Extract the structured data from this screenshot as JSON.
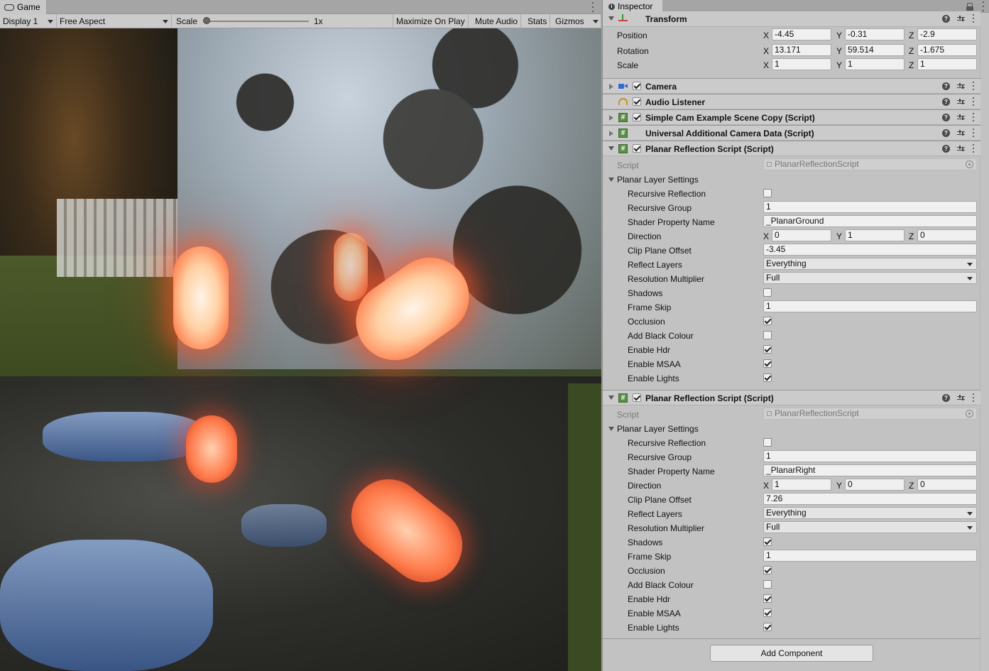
{
  "game": {
    "tab_label": "Game",
    "toolbar": {
      "display": "Display 1",
      "aspect": "Free Aspect",
      "scale_label": "Scale",
      "scale_value": "1x",
      "maximize": "Maximize On Play",
      "mute": "Mute Audio",
      "stats": "Stats",
      "gizmos": "Gizmos"
    }
  },
  "inspector": {
    "tab_label": "Inspector",
    "transform": {
      "title": "Transform",
      "position": {
        "label": "Position",
        "x": "-4.45",
        "y": "-0.31",
        "z": "-2.9"
      },
      "rotation": {
        "label": "Rotation",
        "x": "13.171",
        "y": "59.514",
        "z": "-1.675"
      },
      "scale": {
        "label": "Scale",
        "x": "1",
        "y": "1",
        "z": "1"
      }
    },
    "axis": {
      "x": "X",
      "y": "Y",
      "z": "Z"
    },
    "components": [
      {
        "title": "Camera",
        "checked": true
      },
      {
        "title": "Audio Listener",
        "checked": true
      },
      {
        "title": "Simple Cam Example Scene Copy (Script)",
        "checked": true
      },
      {
        "title": "Universal Additional Camera Data (Script)",
        "checked": false
      }
    ],
    "reflection_scripts": [
      {
        "title": "Planar Reflection Script (Script)",
        "script_label": "Script",
        "script_value": "PlanarReflectionScript",
        "section": "Planar Layer Settings",
        "recursive_reflection": {
          "label": "Recursive Reflection",
          "checked": false
        },
        "recursive_group": {
          "label": "Recursive Group",
          "value": "1"
        },
        "shader_property": {
          "label": "Shader Property Name",
          "value": "_PlanarGround"
        },
        "direction": {
          "label": "Direction",
          "x": "0",
          "y": "1",
          "z": "0"
        },
        "clip_plane_offset": {
          "label": "Clip Plane Offset",
          "value": "-3.45"
        },
        "reflect_layers": {
          "label": "Reflect Layers",
          "value": "Everything"
        },
        "resolution_multiplier": {
          "label": "Resolution Multiplier",
          "value": "Full"
        },
        "shadows": {
          "label": "Shadows",
          "checked": false
        },
        "frame_skip": {
          "label": "Frame Skip",
          "value": "1"
        },
        "occlusion": {
          "label": "Occlusion",
          "checked": true
        },
        "add_black_colour": {
          "label": "Add Black Colour",
          "checked": false
        },
        "enable_hdr": {
          "label": "Enable Hdr",
          "checked": true
        },
        "enable_msaa": {
          "label": "Enable MSAA",
          "checked": true
        },
        "enable_lights": {
          "label": "Enable Lights",
          "checked": true
        }
      },
      {
        "title": "Planar Reflection Script (Script)",
        "script_label": "Script",
        "script_value": "PlanarReflectionScript",
        "section": "Planar Layer Settings",
        "recursive_reflection": {
          "label": "Recursive Reflection",
          "checked": false
        },
        "recursive_group": {
          "label": "Recursive Group",
          "value": "1"
        },
        "shader_property": {
          "label": "Shader Property Name",
          "value": "_PlanarRight"
        },
        "direction": {
          "label": "Direction",
          "x": "1",
          "y": "0",
          "z": "0"
        },
        "clip_plane_offset": {
          "label": "Clip Plane Offset",
          "value": "7.26"
        },
        "reflect_layers": {
          "label": "Reflect Layers",
          "value": "Everything"
        },
        "resolution_multiplier": {
          "label": "Resolution Multiplier",
          "value": "Full"
        },
        "shadows": {
          "label": "Shadows",
          "checked": true
        },
        "frame_skip": {
          "label": "Frame Skip",
          "value": "1"
        },
        "occlusion": {
          "label": "Occlusion",
          "checked": true
        },
        "add_black_colour": {
          "label": "Add Black Colour",
          "checked": false
        },
        "enable_hdr": {
          "label": "Enable Hdr",
          "checked": true
        },
        "enable_msaa": {
          "label": "Enable MSAA",
          "checked": true
        },
        "enable_lights": {
          "label": "Enable Lights",
          "checked": true
        }
      }
    ],
    "add_component": "Add Component"
  }
}
